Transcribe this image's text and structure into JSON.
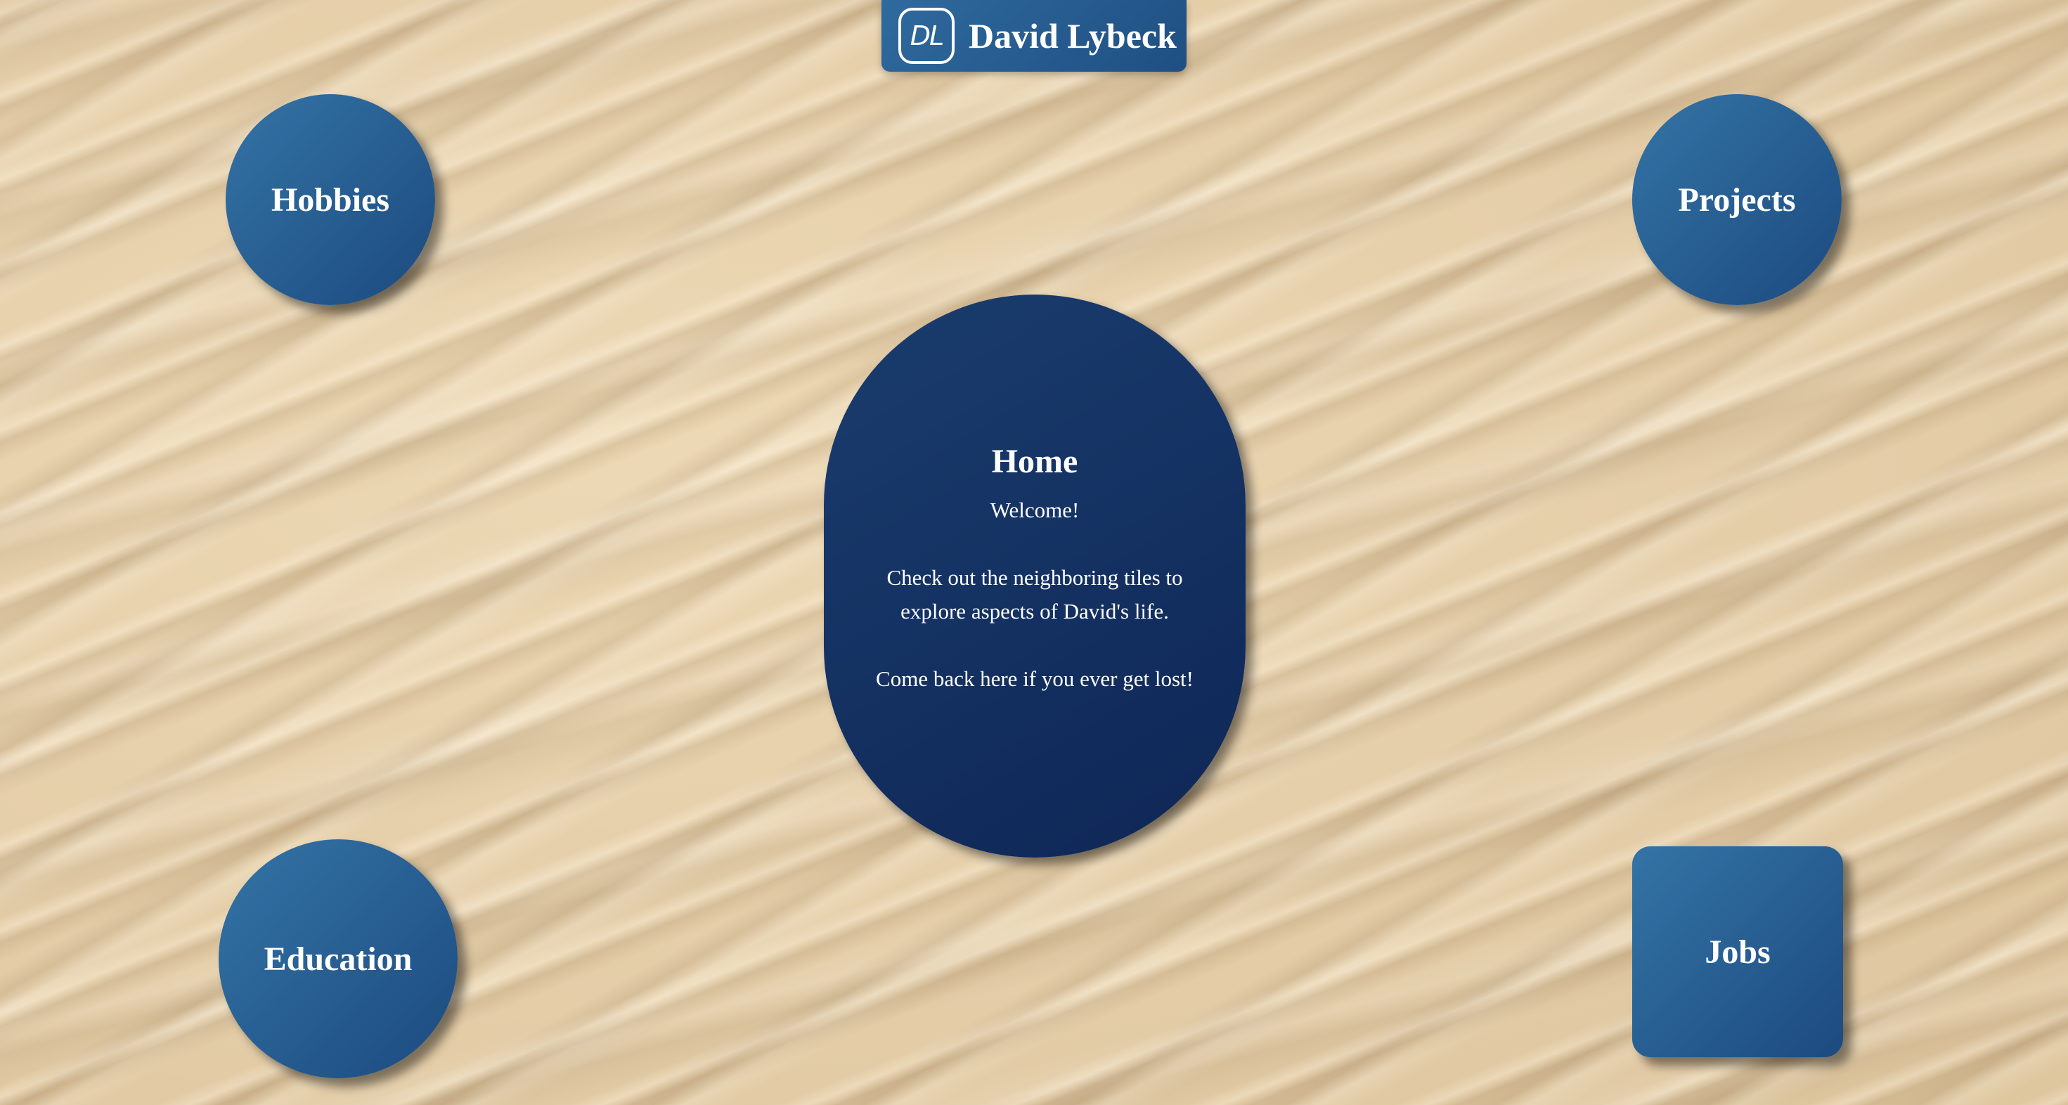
{
  "header": {
    "logo_text": "DL",
    "title": "David Lybeck"
  },
  "tiles": {
    "hobbies": "Hobbies",
    "projects": "Projects",
    "education": "Education",
    "jobs": "Jobs"
  },
  "home": {
    "title": "Home",
    "welcome": "Welcome!",
    "line1": "Check out the neighboring tiles to",
    "line2": "explore aspects of David's life.",
    "line3": "Come back here if you ever get lost!"
  },
  "colors": {
    "tile": "#2a5f94",
    "home": "#132f61",
    "sand": "#e3cca6"
  }
}
